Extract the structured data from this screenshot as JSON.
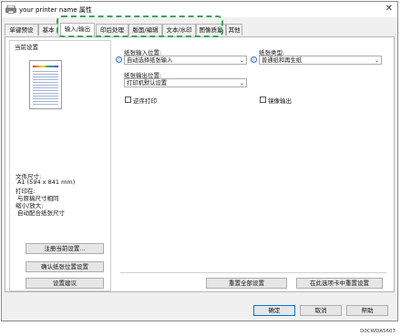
{
  "window": {
    "title": "your printer name 属性",
    "close_glyph": "✕"
  },
  "tabs": [
    {
      "label": "单键预设"
    },
    {
      "label": "基本"
    },
    {
      "label": "输入/输出"
    },
    {
      "label": "印后处理"
    },
    {
      "label": "版面/编辑"
    },
    {
      "label": "文本/水印"
    },
    {
      "label": "图像质量"
    },
    {
      "label": "其他"
    }
  ],
  "left": {
    "current_settings": "当前设置",
    "paper_size_label": "文件尺寸:",
    "paper_size_value": "A1 (594 x 841 mm)",
    "print_on_label": "打印在:",
    "print_on_value": "与原稿尺寸相同",
    "reduce_label": "缩小/放大:",
    "reduce_value": "自动配合纸张尺寸",
    "register_button": "注册当前设置...",
    "confirm_button": "确认纸张位置设置",
    "manage_button": "设置建议"
  },
  "input": {
    "tray_label": "纸张输入位置:",
    "tray_value": "自动选择纸张输入",
    "type_label": "纸张类型:",
    "type_value": "普通纸和再生纸",
    "output_label": "纸张输出位置:",
    "output_value": "打印机默认设置",
    "reverse_label": "逆序打印",
    "mirror_label": "镜像输出"
  },
  "panel_buttons": {
    "reset_all": "重置全部设置",
    "reset_tab": "在此选项卡中重置设置"
  },
  "dialog": {
    "ok": "确定",
    "cancel": "取消",
    "help": "帮助"
  },
  "footnote": "D0CWDA5607",
  "colors": {
    "highlight": "#3aa55c",
    "info_icon": "#2a6cd6"
  }
}
